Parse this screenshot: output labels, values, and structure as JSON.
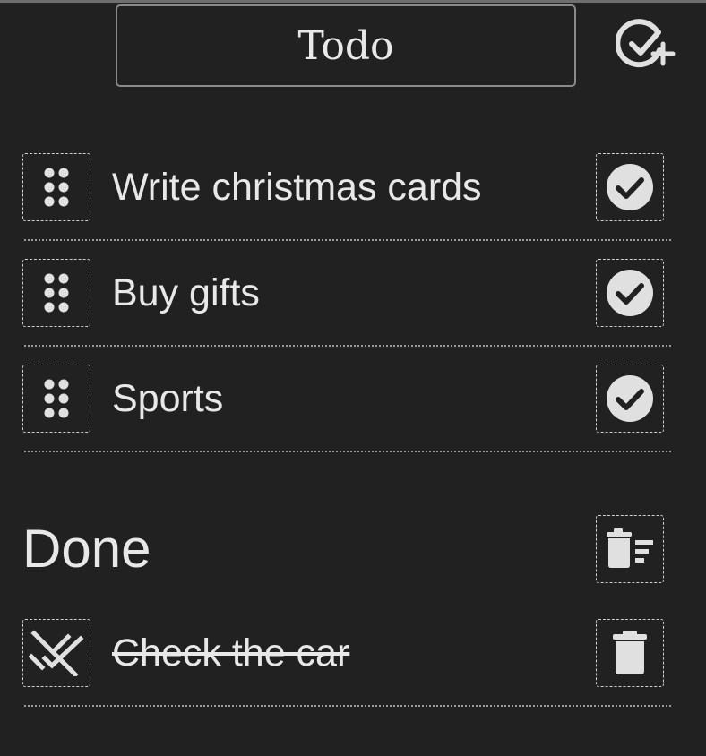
{
  "header": {
    "title_value": "Todo",
    "add_icon": "check-circle-plus-icon"
  },
  "todo": {
    "items": [
      {
        "label": "Write christmas cards",
        "drag_icon": "drag-handle-icon",
        "action_icon": "check-circle-icon"
      },
      {
        "label": "Buy gifts",
        "drag_icon": "drag-handle-icon",
        "action_icon": "check-circle-icon"
      },
      {
        "label": "Sports",
        "drag_icon": "drag-handle-icon",
        "action_icon": "check-circle-icon"
      }
    ]
  },
  "done": {
    "title": "Done",
    "clear_icon": "clear-all-trash-icon",
    "items": [
      {
        "label": "Check the car",
        "uncheck_icon": "remove-done-icon",
        "delete_icon": "trash-icon"
      }
    ]
  }
}
